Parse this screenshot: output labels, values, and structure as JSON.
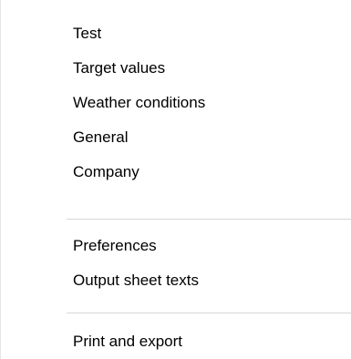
{
  "menu": {
    "items": [
      {
        "label": "Test"
      },
      {
        "label": "Target values"
      },
      {
        "label": "Weather conditions"
      },
      {
        "label": "General"
      },
      {
        "label": "Company"
      },
      {
        "label": "Preferences"
      },
      {
        "label": "Output sheet texts"
      },
      {
        "label": "Print and export"
      }
    ]
  }
}
